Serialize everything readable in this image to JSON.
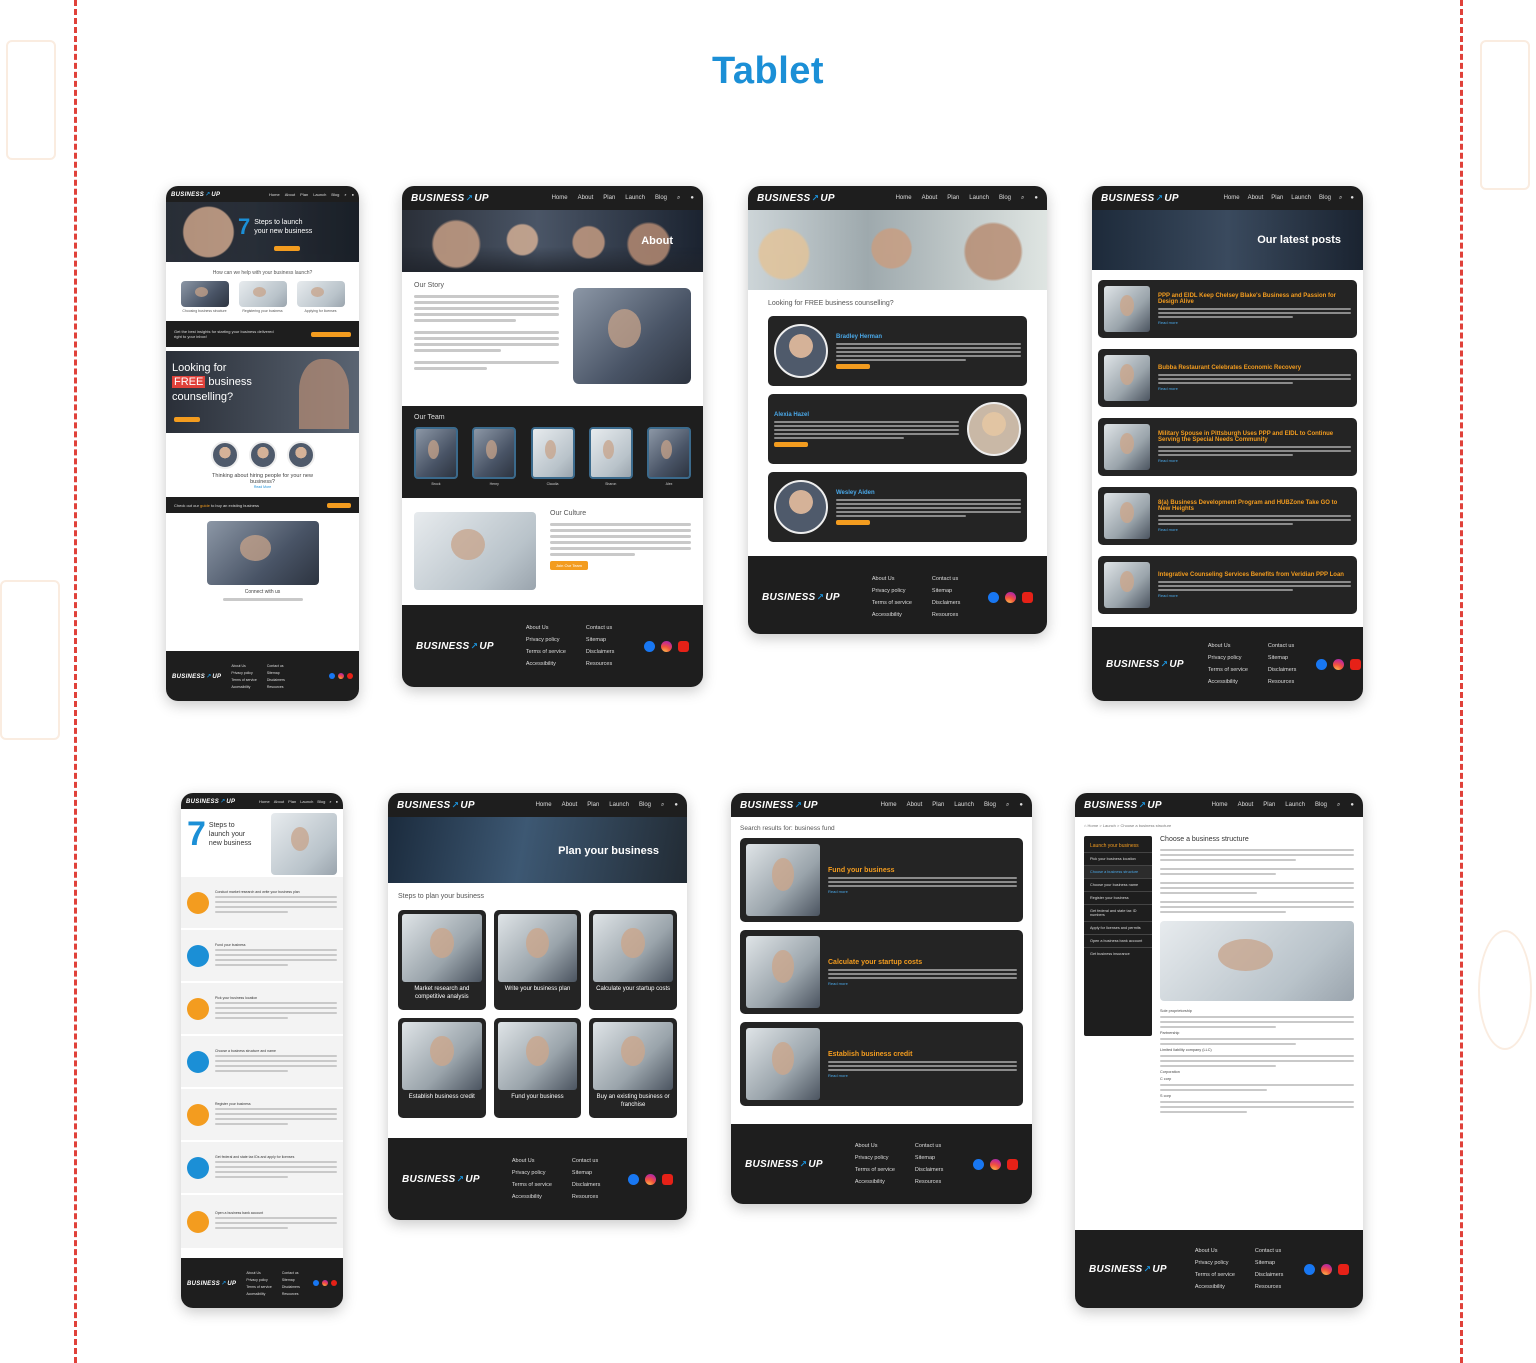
{
  "title": "Tablet",
  "nav": {
    "logo_left": "BUSINESS",
    "logo_right": "UP",
    "links": [
      "Home",
      "About",
      "Plan",
      "Launch",
      "Blog"
    ]
  },
  "footer": {
    "col1": [
      "About Us",
      "Privacy policy",
      "Terms of service",
      "Accessibility"
    ],
    "col2": [
      "Contact us",
      "Sitemap",
      "Disclaimers",
      "Resources"
    ]
  },
  "home": {
    "hero_number": "7",
    "hero_line1": "Steps to launch",
    "hero_line2": "your new business",
    "help_heading": "How can we help with your business launch?",
    "cards": [
      "Choosing business structure",
      "Registering your business",
      "Applying for licenses"
    ],
    "insights": "Get the best insights for starting your business delivered right to your inbox!",
    "free_line1": "Looking for",
    "free_highlight": "FREE",
    "free_line2": "business",
    "free_line3": "counselling?",
    "hiring": "Thinking about hiring people for your new business?",
    "read_more": "Read More",
    "guide_prefix": "Check out our",
    "guide_link": "guide",
    "guide_suffix": "to buy an existing business",
    "connect": "Connect with us"
  },
  "about": {
    "hero_title": "About",
    "story_title": "Our Story",
    "team_title": "Our Team",
    "team": [
      "Brock",
      "Henry",
      "Claudia",
      "Sharon",
      "Alex"
    ],
    "culture_title": "Our Culture",
    "join_button": "Join Our Team"
  },
  "counselling": {
    "heading": "Looking for FREE business counselling?",
    "advisors": [
      "Bradley Herman",
      "Alexia Hazel",
      "Wesley Aiden"
    ],
    "button": "Check Availability"
  },
  "blog": {
    "hero_title": "Our latest posts",
    "posts": [
      "PPP and EIDL Keep Chelsey Blake's Business and Passion for Design Alive",
      "Bubba Restaurant Celebrates Economic Recovery",
      "Military Spouse in Pittsburgh Uses PPP and EIDL to Continue Serving the Special Needs Community",
      "8(a) Business Development Program and HUBZone Take GO to New Heights",
      "Integrative Counseling Services Benefits from Veridian PPP Loan"
    ],
    "read_more": "Read more"
  },
  "steps": {
    "number": "7",
    "line1": "Steps to",
    "line2": "launch your",
    "line3": "new business",
    "items": [
      "Conduct market research and write your business plan",
      "Fund your business",
      "Pick your business location",
      "Choose a business structure and name",
      "Register your business",
      "Get federal and state tax IDs and apply for licenses",
      "Open a business bank account"
    ]
  },
  "plan": {
    "hero_title": "Plan your business",
    "steps_title": "Steps to plan your business",
    "tiles": [
      "Market research and competitive analysis",
      "Write your business plan",
      "Calculate your startup costs",
      "Establish business credit",
      "Fund your business",
      "Buy an existing business or franchise"
    ]
  },
  "search": {
    "label": "Search results for:",
    "query": "business fund",
    "results": [
      "Fund your business",
      "Calculate your startup costs",
      "Establish business credit"
    ],
    "read_more": "Read more"
  },
  "launch": {
    "breadcrumb": [
      "Home",
      "Launch",
      "Choose a business structure"
    ],
    "side_title": "Launch your business",
    "side_items": [
      "Pick your business location",
      "Choose a business structure",
      "Choose your business name",
      "Register your business",
      "Get federal and state tax ID numbers",
      "Apply for licenses and permits",
      "Open a business bank account",
      "Get business insurance"
    ],
    "title": "Choose a business structure",
    "subheads": [
      "Sole proprietorship",
      "Partnership",
      "Limited liability company (LLC)",
      "Corporation",
      "C corp",
      "S corp"
    ]
  }
}
